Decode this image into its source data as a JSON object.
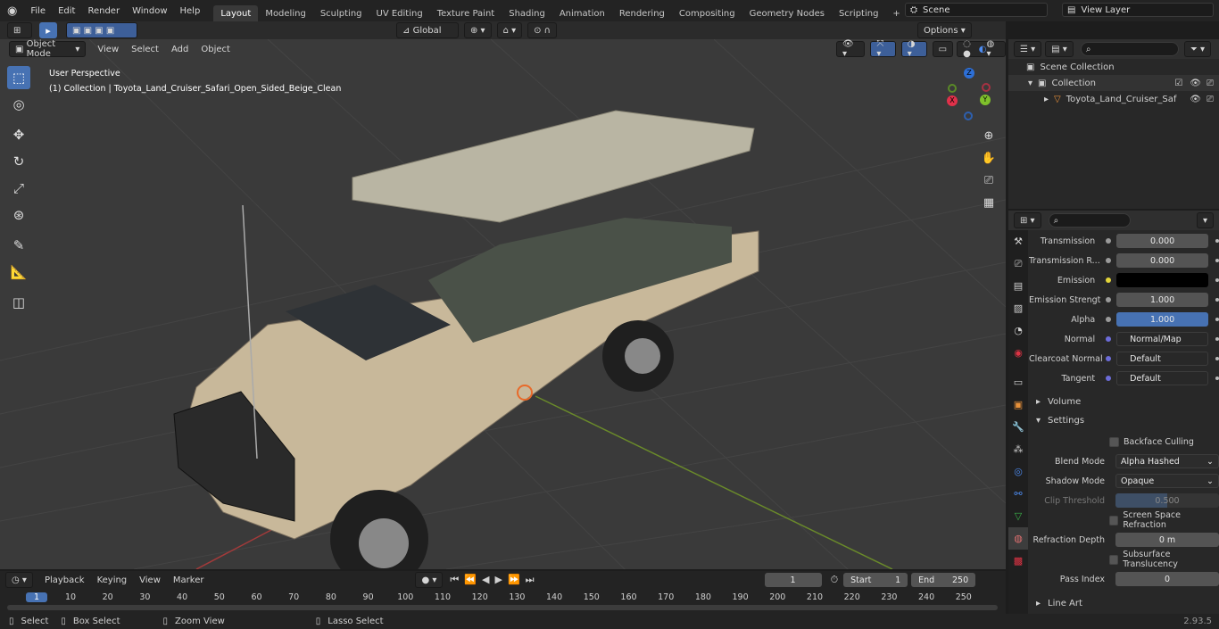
{
  "topbar": {
    "menus": [
      "File",
      "Edit",
      "Render",
      "Window",
      "Help"
    ],
    "workspaces": [
      "Layout",
      "Modeling",
      "Sculpting",
      "UV Editing",
      "Texture Paint",
      "Shading",
      "Animation",
      "Rendering",
      "Compositing",
      "Geometry Nodes",
      "Scripting"
    ],
    "scene": "Scene",
    "view_layer": "View Layer"
  },
  "viewport": {
    "mode": "Object Mode",
    "menus": [
      "View",
      "Select",
      "Add",
      "Object"
    ],
    "transform": "Global",
    "options": "Options",
    "perspective": "User Perspective",
    "collection_info": "(1) Collection | Toyota_Land_Cruiser_Safari_Open_Sided_Beige_Clean",
    "gizmo": {
      "z": "Z",
      "y": "Y",
      "x": "X"
    }
  },
  "outliner": {
    "scene_collection": "Scene Collection",
    "collection": "Collection",
    "object": "Toyota_Land_Cruiser_Saf"
  },
  "properties": {
    "rows": [
      {
        "label": "Transmission",
        "value": "0.000",
        "dot": "#9a9a9a"
      },
      {
        "label": "Transmission R...",
        "value": "0.000",
        "dot": "#9a9a9a"
      },
      {
        "label": "Emission",
        "value": "",
        "dot": "#e3d53a"
      },
      {
        "label": "Emission Strengt",
        "value": "1.000",
        "dot": "#9a9a9a"
      },
      {
        "label": "Alpha",
        "value": "1.000",
        "dot": "#9a9a9a"
      },
      {
        "label": "Normal",
        "value": "Normal/Map",
        "dot": "#6c6cd9"
      },
      {
        "label": "Clearcoat Normal",
        "value": "Default",
        "dot": "#6c6cd9"
      },
      {
        "label": "Tangent",
        "value": "Default",
        "dot": "#6c6cd9"
      }
    ],
    "volume": "Volume",
    "settings": "Settings",
    "backface": "Backface Culling",
    "blend_label": "Blend Mode",
    "blend_value": "Alpha Hashed",
    "shadow_label": "Shadow Mode",
    "shadow_value": "Opaque",
    "clip_label": "Clip Threshold",
    "clip_value": "0.500",
    "ssr": "Screen Space Refraction",
    "refraction_label": "Refraction Depth",
    "refraction_value": "0 m",
    "sss": "Subsurface Translucency",
    "pass_label": "Pass Index",
    "pass_value": "0",
    "line_art": "Line Art"
  },
  "timeline": {
    "menus": [
      "Playback",
      "Keying",
      "View",
      "Marker"
    ],
    "frame": "1",
    "start_label": "Start",
    "start": "1",
    "end_label": "End",
    "end": "250",
    "ticks": [
      "1",
      "10",
      "20",
      "30",
      "40",
      "50",
      "60",
      "70",
      "80",
      "90",
      "100",
      "110",
      "120",
      "130",
      "140",
      "150",
      "160",
      "170",
      "180",
      "190",
      "200",
      "210",
      "220",
      "230",
      "240",
      "250"
    ]
  },
  "status": {
    "select": "Select",
    "box_select": "Box Select",
    "zoom_view": "Zoom View",
    "lasso_select": "Lasso Select",
    "version": "2.93.5"
  }
}
